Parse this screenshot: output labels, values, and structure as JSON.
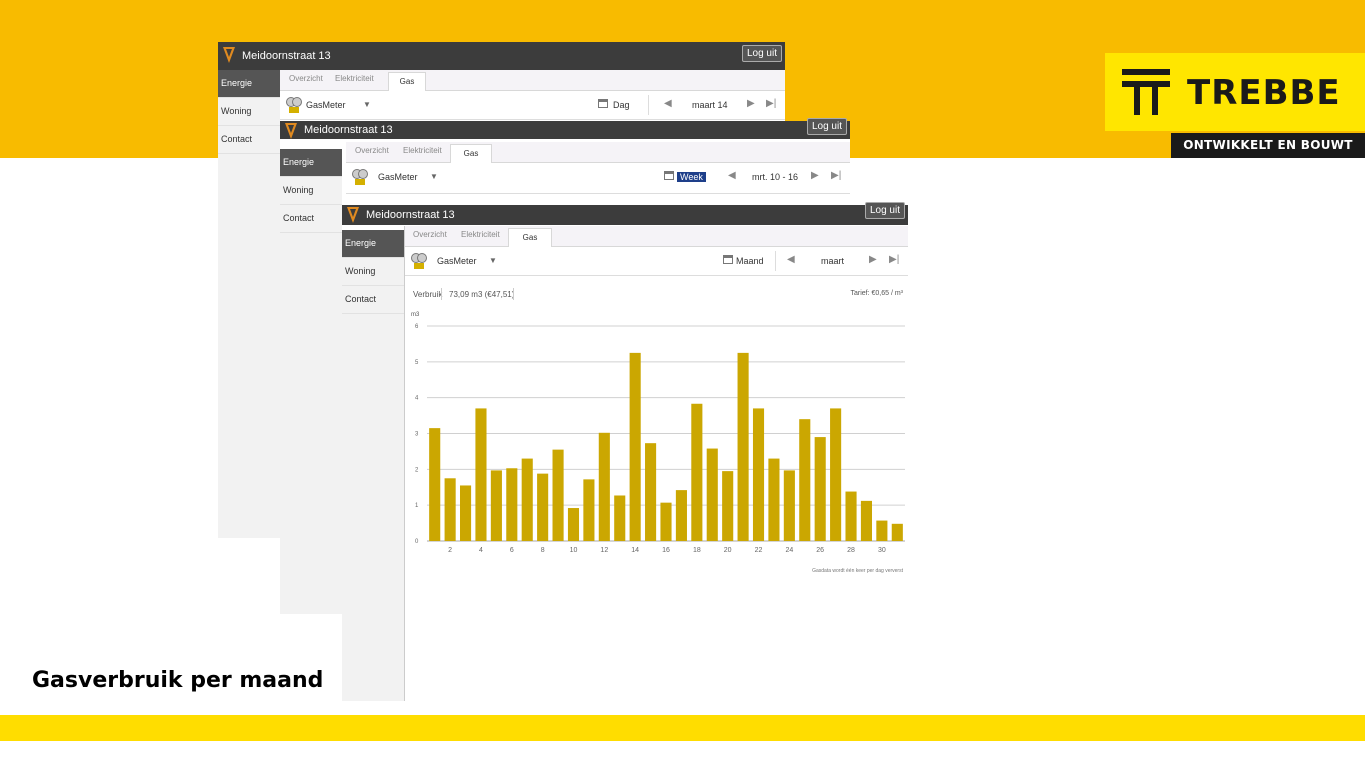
{
  "brand": {
    "name": "TREBBE",
    "tagline": "ONTWIKKELT EN BOUWT",
    "yellow": "#f8bb00",
    "logo_yellow": "#ffe600"
  },
  "caption": "Gasverbruik per maand",
  "windows": [
    {
      "title": "Meidoornstraat 13",
      "logout": "Log uit",
      "sidebar": [
        "Energie",
        "Woning",
        "Contact"
      ],
      "tabs": [
        "Overzicht",
        "Elektriciteit",
        "Gas"
      ],
      "active_tab": "Gas",
      "meter": "GasMeter",
      "period_mode": "Dag",
      "period_label": "maart 14"
    },
    {
      "title": "Meidoornstraat 13",
      "logout": "Log uit",
      "sidebar": [
        "Energie",
        "Woning",
        "Contact"
      ],
      "tabs": [
        "Overzicht",
        "Elektriciteit",
        "Gas"
      ],
      "active_tab": "Gas",
      "meter": "GasMeter",
      "period_mode": "Week",
      "period_label": "mrt. 10 - 16"
    },
    {
      "title": "Meidoornstraat 13",
      "logout": "Log uit",
      "sidebar": [
        "Energie",
        "Woning",
        "Contact"
      ],
      "tabs": [
        "Overzicht",
        "Elektriciteit",
        "Gas"
      ],
      "active_tab": "Gas",
      "meter": "GasMeter",
      "period_mode": "Maand",
      "period_label": "maart",
      "usage_label": "Verbruik",
      "usage_value": "73,09 m3 (€47,51)",
      "tariff": "Tarief: €0,65 / m³",
      "footnote": "Gasdata wordt één keer per dag ververst"
    }
  ],
  "chart_data": {
    "type": "bar",
    "ylabel": "m3",
    "ylim": [
      0,
      6
    ],
    "yticks": [
      0,
      1,
      2,
      3,
      4,
      5,
      6
    ],
    "xticks": [
      2,
      4,
      6,
      8,
      10,
      12,
      14,
      16,
      18,
      20,
      22,
      24,
      26,
      28,
      30
    ],
    "categories": [
      1,
      2,
      3,
      4,
      5,
      6,
      7,
      8,
      9,
      10,
      11,
      12,
      13,
      14,
      15,
      16,
      17,
      18,
      19,
      20,
      21,
      22,
      23,
      24,
      25,
      26,
      27,
      28,
      29,
      30,
      31
    ],
    "values": [
      3.15,
      1.75,
      1.55,
      3.7,
      1.97,
      2.03,
      2.3,
      1.88,
      2.55,
      0.92,
      1.72,
      3.02,
      1.27,
      5.25,
      2.73,
      1.07,
      1.42,
      3.83,
      2.58,
      1.95,
      5.25,
      3.7,
      2.3,
      1.97,
      3.4,
      2.9,
      3.7,
      1.38,
      1.12,
      0.57,
      0.48
    ],
    "grid": true,
    "bar_color": "#cba701"
  }
}
